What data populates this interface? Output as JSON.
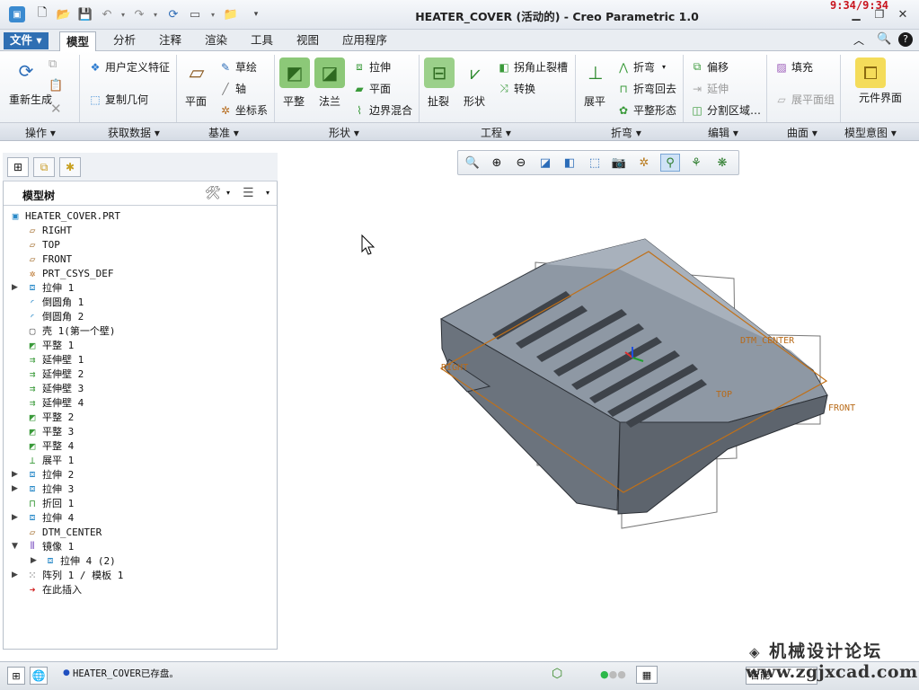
{
  "window": {
    "title": "HEATER_COVER (活动的) - Creo Parametric 1.0",
    "clock": "9:34/9:34"
  },
  "tabs": [
    "文件",
    "模型",
    "分析",
    "注释",
    "渲染",
    "工具",
    "视图",
    "应用程序"
  ],
  "active_tab": "模型",
  "ribbon": {
    "regenerate_label": "重新生成",
    "user_feature": "用户定义特征",
    "copy_geometry": "复制几何",
    "plane": "平面",
    "sketch": "草绘",
    "axis": "轴",
    "csys": "坐标系",
    "flat": "平整",
    "flange": "法兰",
    "extrude": "拉伸",
    "flat_plane": "平面",
    "boundary_blend": "边界混合",
    "rip": "扯裂",
    "form": "形状",
    "corner_relief": "拐角止裂槽",
    "convert": "转换",
    "unbend": "展平",
    "bend": "折弯",
    "bend_back": "折弯回去",
    "flat_pattern": "平整形态",
    "offset": "偏移",
    "extend": "延伸",
    "split_area": "分割区域…",
    "fill": "填充",
    "flatten_quilt": "展平面组",
    "component_interface": "元件界面"
  },
  "groups": [
    "操作",
    "获取数据",
    "基准",
    "形状",
    "工程",
    "折弯",
    "编辑",
    "曲面",
    "模型意图"
  ],
  "panel": {
    "title": "模型树",
    "tree": [
      {
        "label": "HEATER_COVER.PRT",
        "icon": "part-icon",
        "indent": 0,
        "expand": ""
      },
      {
        "label": "RIGHT",
        "icon": "datum-plane-icon",
        "indent": 1,
        "expand": ""
      },
      {
        "label": "TOP",
        "icon": "datum-plane-icon",
        "indent": 1,
        "expand": ""
      },
      {
        "label": "FRONT",
        "icon": "datum-plane-icon",
        "indent": 1,
        "expand": ""
      },
      {
        "label": "PRT_CSYS_DEF",
        "icon": "csys-icon",
        "indent": 1,
        "expand": ""
      },
      {
        "label": "拉伸 1",
        "icon": "extrude-icon",
        "indent": 1,
        "expand": "▶"
      },
      {
        "label": "倒圆角 1",
        "icon": "round-icon",
        "indent": 1,
        "expand": ""
      },
      {
        "label": "倒圆角 2",
        "icon": "round-icon",
        "indent": 1,
        "expand": ""
      },
      {
        "label": "壳 1(第一个壁)",
        "icon": "shell-icon",
        "indent": 1,
        "expand": ""
      },
      {
        "label": "平整 1",
        "icon": "flat-wall-icon",
        "indent": 1,
        "expand": ""
      },
      {
        "label": "延伸壁 1",
        "icon": "extend-wall-icon",
        "indent": 1,
        "expand": ""
      },
      {
        "label": "延伸壁 2",
        "icon": "extend-wall-icon",
        "indent": 1,
        "expand": ""
      },
      {
        "label": "延伸壁 3",
        "icon": "extend-wall-icon",
        "indent": 1,
        "expand": ""
      },
      {
        "label": "延伸壁 4",
        "icon": "extend-wall-icon",
        "indent": 1,
        "expand": ""
      },
      {
        "label": "平整 2",
        "icon": "flat-wall-icon",
        "indent": 1,
        "expand": ""
      },
      {
        "label": "平整 3",
        "icon": "flat-wall-icon",
        "indent": 1,
        "expand": ""
      },
      {
        "label": "平整 4",
        "icon": "flat-wall-icon",
        "indent": 1,
        "expand": ""
      },
      {
        "label": "展平 1",
        "icon": "unbend-icon",
        "indent": 1,
        "expand": ""
      },
      {
        "label": "拉伸 2",
        "icon": "extrude-icon",
        "indent": 1,
        "expand": "▶"
      },
      {
        "label": "拉伸 3",
        "icon": "extrude-icon",
        "indent": 1,
        "expand": "▶"
      },
      {
        "label": "折回 1",
        "icon": "bend-back-icon",
        "indent": 1,
        "expand": ""
      },
      {
        "label": "拉伸 4",
        "icon": "extrude-icon",
        "indent": 1,
        "expand": "▶"
      },
      {
        "label": "DTM_CENTER",
        "icon": "datum-plane-icon",
        "indent": 1,
        "expand": ""
      },
      {
        "label": "镜像 1",
        "icon": "mirror-icon",
        "indent": 1,
        "expand": "▼"
      },
      {
        "label": "拉伸 4 (2)",
        "icon": "extrude-icon",
        "indent": 2,
        "expand": "▶"
      },
      {
        "label": "阵列 1 / 模板 1",
        "icon": "pattern-icon",
        "indent": 1,
        "expand": "▶"
      },
      {
        "label": "在此插入",
        "icon": "insert-here-icon",
        "indent": 1,
        "expand": ""
      }
    ]
  },
  "viewport": {
    "labels": {
      "right": "RIGHT",
      "top": "TOP",
      "front": "FRONT",
      "dtm_center": "DTM_CENTER"
    }
  },
  "status": {
    "message": "HEATER_COVER已存盘。",
    "filter": "智能"
  },
  "watermark": {
    "line1": "机械设计论坛",
    "line2": "www.zgjxcad.com"
  }
}
